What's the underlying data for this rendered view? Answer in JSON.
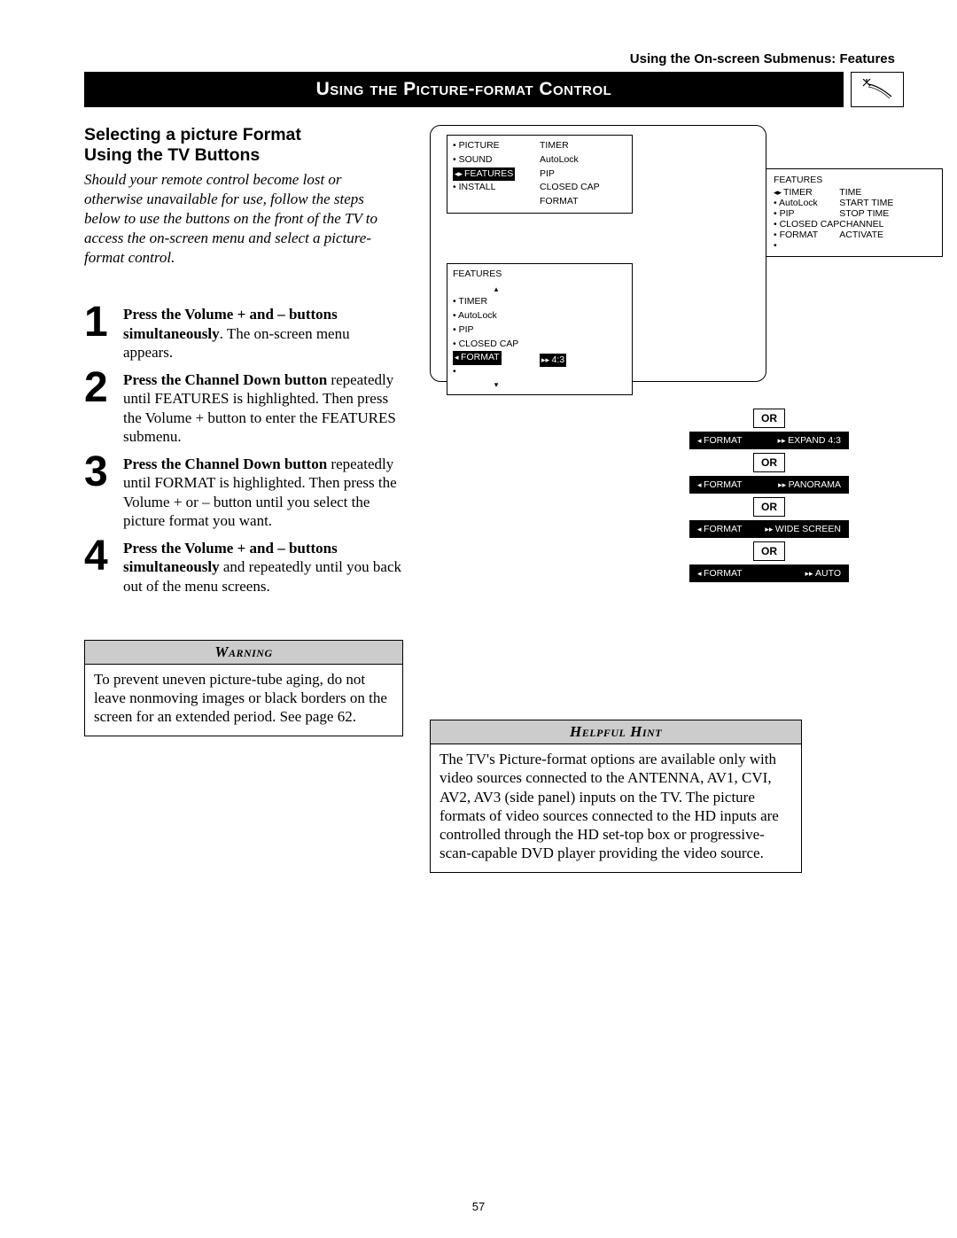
{
  "breadcrumb": "Using the On-screen Submenus: Features",
  "title": "Using the Picture-format Control",
  "section_heading_1": "Selecting a picture Format",
  "section_heading_2": "Using the TV Buttons",
  "intro": "Should your remote control become lost or otherwise unavailable for use, follow the steps below to use the buttons on the front of the TV to access the on-screen menu and select a picture-format control.",
  "steps": [
    {
      "num": "1",
      "bold": "Press the Volume + and – buttons simultaneously",
      "rest": ". The on-screen menu appears."
    },
    {
      "num": "2",
      "bold": "Press the Channel Down button",
      "rest": " repeatedly until FEATURES is highlighted. Then press the Volume + button to enter the FEATURES submenu."
    },
    {
      "num": "3",
      "bold": "Press the Channel Down button",
      "rest": " repeatedly until FORMAT is highlighted. Then press the Volume + or – button until you select the picture format you want."
    },
    {
      "num": "4",
      "bold": "Press the Volume + and – buttons simultaneously",
      "rest": " and repeatedly until you back out of the menu screens."
    }
  ],
  "warning": {
    "title": "Warning",
    "body": "To prevent uneven picture-tube aging, do not leave nonmoving images or black borders on the screen for an extended period. See page 62."
  },
  "hint": {
    "title": "Helpful Hint",
    "body": "The TV's Picture-format options are available only with video sources connected to the ANTENNA, AV1, CVI, AV2, AV3 (side panel) inputs on the TV. The picture formats of video sources connected to the HD inputs are controlled through the HD set-top box or progressive-scan-capable DVD player providing the video source."
  },
  "osd_main": {
    "left_items": [
      "PICTURE",
      "SOUND",
      "FEATURES",
      "INSTALL"
    ],
    "right_items": [
      "TIMER",
      "AutoLock",
      "PIP",
      "CLOSED CAP",
      "FORMAT"
    ],
    "highlighted": "FEATURES"
  },
  "osd_features_large": {
    "title": "FEATURES",
    "left": [
      "TIMER",
      "AutoLock",
      "PIP",
      "CLOSED CAP",
      "FORMAT",
      ""
    ],
    "right": [
      "TIME",
      "START TIME",
      "STOP TIME",
      "CHANNEL",
      "ACTIVATE"
    ],
    "highlighted": "TIMER"
  },
  "osd_features_small": {
    "title": "FEATURES",
    "items": [
      "TIMER",
      "AutoLock",
      "PIP",
      "CLOSED CAP",
      "FORMAT",
      ""
    ],
    "highlighted": "FORMAT",
    "value": "4:3"
  },
  "format_options": [
    {
      "label": "FORMAT",
      "value": "EXPAND 4:3"
    },
    {
      "label": "FORMAT",
      "value": "PANORAMA"
    },
    {
      "label": "FORMAT",
      "value": "WIDE SCREEN"
    },
    {
      "label": "FORMAT",
      "value": "AUTO"
    }
  ],
  "or_label": "OR",
  "page_number": "57"
}
